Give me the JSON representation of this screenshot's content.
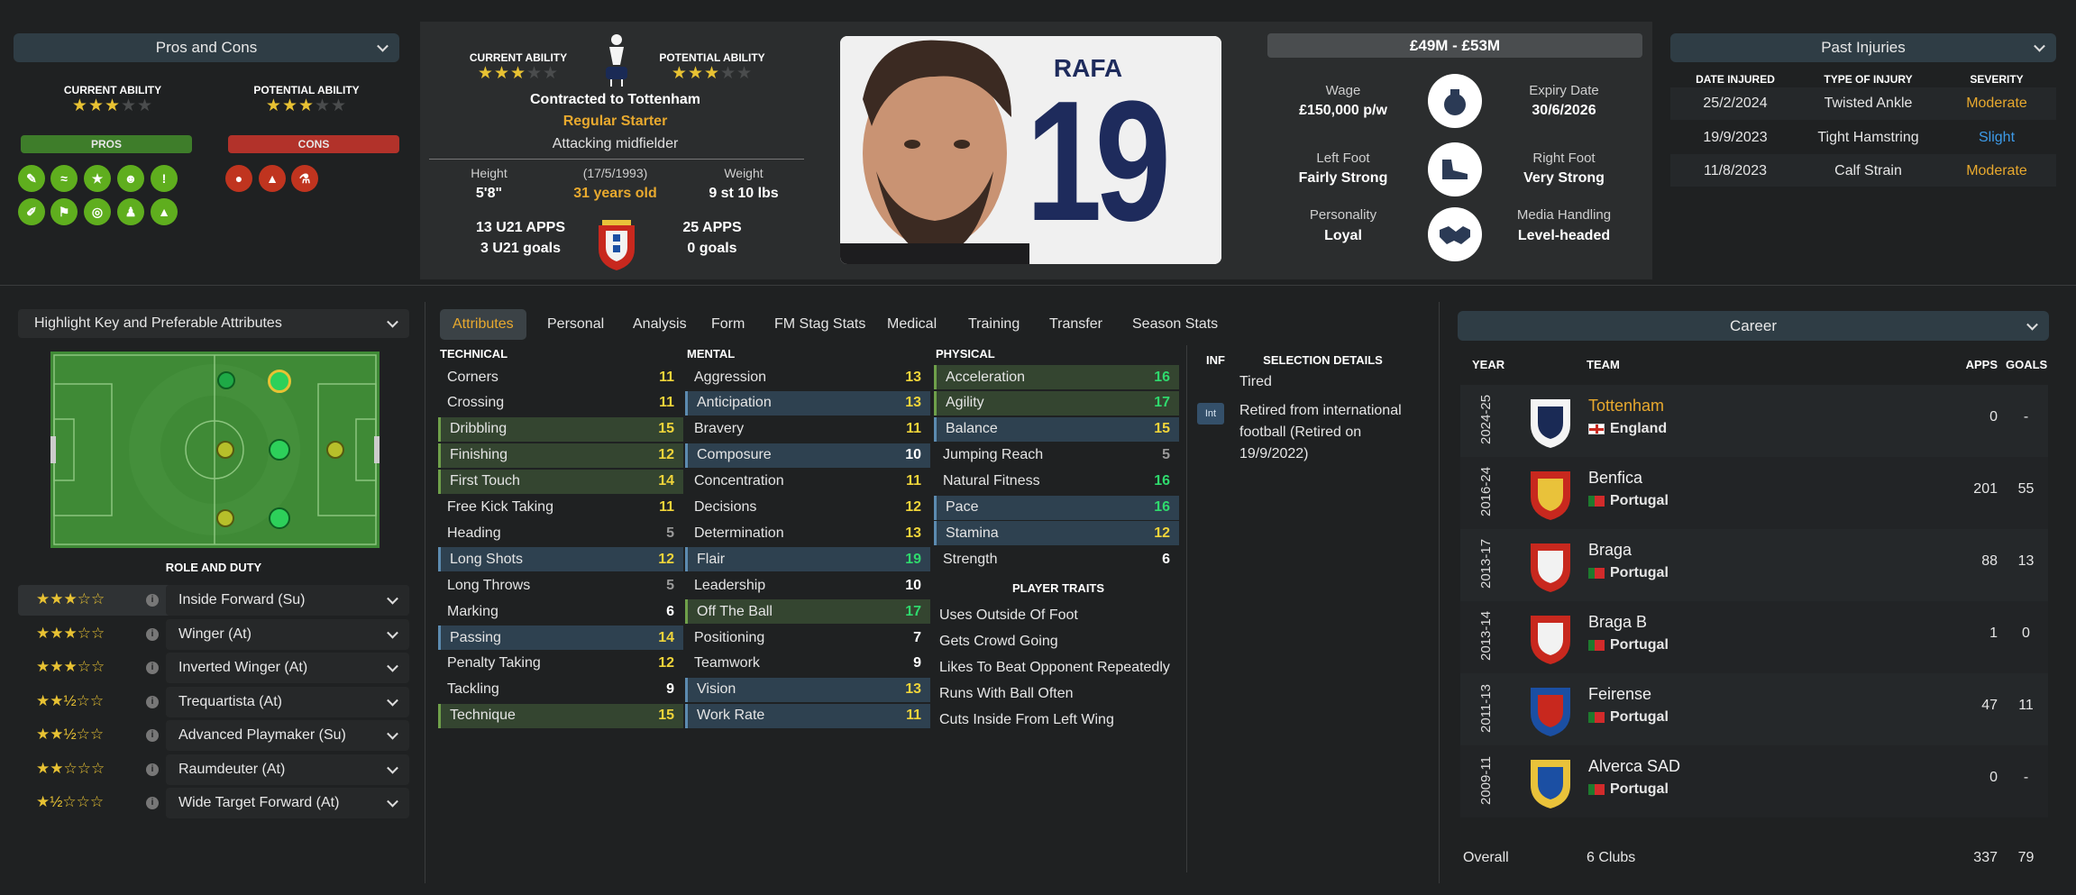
{
  "pros_cons": {
    "title": "Pros and Cons",
    "current_ability": "CURRENT ABILITY",
    "potential_ability": "POTENTIAL ABILITY",
    "current_stars": 3,
    "potential_stars": 3,
    "pros_label": "PROS",
    "cons_label": "CONS"
  },
  "profile": {
    "current_ability": "CURRENT ABILITY",
    "potential_ability": "POTENTIAL ABILITY",
    "contract": "Contracted to Tottenham",
    "status": "Regular Starter",
    "position": "Attacking midfielder",
    "height_label": "Height",
    "height": "5'8\"",
    "dob": "(17/5/1993)",
    "age": "31 years old",
    "weight_label": "Weight",
    "weight": "9 st 10 lbs",
    "u21_apps": "13 U21 APPS",
    "u21_goals": "3 U21 goals",
    "apps": "25 APPS",
    "goals": "0 goals"
  },
  "photo": {
    "name": "RAFA",
    "number": "19"
  },
  "details": {
    "value": "£49M - £53M",
    "wage_label": "Wage",
    "wage": "£150,000 p/w",
    "expiry_label": "Expiry Date",
    "expiry": "30/6/2026",
    "left_foot_label": "Left Foot",
    "left_foot": "Fairly Strong",
    "right_foot_label": "Right Foot",
    "right_foot": "Very Strong",
    "personality_label": "Personality",
    "personality": "Loyal",
    "media_label": "Media Handling",
    "media": "Level-headed"
  },
  "injuries": {
    "title": "Past Injuries",
    "headers": [
      "DATE INJURED",
      "TYPE OF INJURY",
      "SEVERITY"
    ],
    "rows": [
      {
        "date": "25/2/2024",
        "type": "Twisted Ankle",
        "severity": "Moderate",
        "color": "#e8a92e"
      },
      {
        "date": "19/9/2023",
        "type": "Tight Hamstring",
        "severity": "Slight",
        "color": "#3d9be9"
      },
      {
        "date": "11/8/2023",
        "type": "Calf Strain",
        "severity": "Moderate",
        "color": "#e8a92e"
      }
    ]
  },
  "highlight": {
    "title": "Highlight Key and Preferable Attributes",
    "role_duty": "ROLE AND DUTY"
  },
  "roles": [
    {
      "name": "Inside Forward (Su)",
      "stars": "★★★☆☆"
    },
    {
      "name": "Winger (At)",
      "stars": "★★★☆☆"
    },
    {
      "name": "Inverted Winger (At)",
      "stars": "★★★☆☆"
    },
    {
      "name": "Trequartista (At)",
      "stars": "★★½☆☆"
    },
    {
      "name": "Advanced Playmaker (Su)",
      "stars": "★★½☆☆"
    },
    {
      "name": "Raumdeuter (At)",
      "stars": "★★☆☆☆"
    },
    {
      "name": "Wide Target Forward (At)",
      "stars": "★½☆☆☆"
    }
  ],
  "tabs": [
    "Attributes",
    "Personal",
    "Analysis",
    "Form",
    "FM Stag Stats",
    "Medical",
    "Training",
    "Transfer",
    "Season Stats"
  ],
  "technical": {
    "title": "TECHNICAL",
    "items": [
      {
        "n": "Corners",
        "v": "11"
      },
      {
        "n": "Crossing",
        "v": "11"
      },
      {
        "n": "Dribbling",
        "v": "15"
      },
      {
        "n": "Finishing",
        "v": "12"
      },
      {
        "n": "First Touch",
        "v": "14"
      },
      {
        "n": "Free Kick Taking",
        "v": "11"
      },
      {
        "n": "Heading",
        "v": "5"
      },
      {
        "n": "Long Shots",
        "v": "12"
      },
      {
        "n": "Long Throws",
        "v": "5"
      },
      {
        "n": "Marking",
        "v": "6"
      },
      {
        "n": "Passing",
        "v": "14"
      },
      {
        "n": "Penalty Taking",
        "v": "12"
      },
      {
        "n": "Tackling",
        "v": "9"
      },
      {
        "n": "Technique",
        "v": "15"
      }
    ]
  },
  "mental": {
    "title": "MENTAL",
    "items": [
      {
        "n": "Aggression",
        "v": "13"
      },
      {
        "n": "Anticipation",
        "v": "13"
      },
      {
        "n": "Bravery",
        "v": "11"
      },
      {
        "n": "Composure",
        "v": "10"
      },
      {
        "n": "Concentration",
        "v": "11"
      },
      {
        "n": "Decisions",
        "v": "12"
      },
      {
        "n": "Determination",
        "v": "13"
      },
      {
        "n": "Flair",
        "v": "19"
      },
      {
        "n": "Leadership",
        "v": "10"
      },
      {
        "n": "Off The Ball",
        "v": "17"
      },
      {
        "n": "Positioning",
        "v": "7"
      },
      {
        "n": "Teamwork",
        "v": "9"
      },
      {
        "n": "Vision",
        "v": "13"
      },
      {
        "n": "Work Rate",
        "v": "11"
      }
    ]
  },
  "physical": {
    "title": "PHYSICAL",
    "items": [
      {
        "n": "Acceleration",
        "v": "16"
      },
      {
        "n": "Agility",
        "v": "17"
      },
      {
        "n": "Balance",
        "v": "15"
      },
      {
        "n": "Jumping Reach",
        "v": "5"
      },
      {
        "n": "Natural Fitness",
        "v": "16"
      },
      {
        "n": "Pace",
        "v": "16"
      },
      {
        "n": "Stamina",
        "v": "12"
      },
      {
        "n": "Strength",
        "v": "6"
      }
    ]
  },
  "traits": {
    "title": "PLAYER TRAITS",
    "items": [
      "Uses Outside Of Foot",
      "Gets Crowd Going",
      "Likes To Beat Opponent Repeatedly",
      "Runs With Ball Often",
      "Cuts Inside From Left Wing"
    ]
  },
  "selection": {
    "inf": "INF",
    "title": "SELECTION DETAILS",
    "tired": "Tired",
    "int_badge": "Int",
    "retired": "Retired from international football (Retired on 19/9/2022)"
  },
  "career": {
    "title": "Career",
    "headers": {
      "year": "YEAR",
      "team": "TEAM",
      "apps": "APPS",
      "goals": "GOALS"
    },
    "rows": [
      {
        "year": "2024-25",
        "team": "Tottenham",
        "country": "England",
        "apps": "0",
        "goals": "-"
      },
      {
        "year": "2016-24",
        "team": "Benfica",
        "country": "Portugal",
        "apps": "201",
        "goals": "55"
      },
      {
        "year": "2013-17",
        "team": "Braga",
        "country": "Portugal",
        "apps": "88",
        "goals": "13"
      },
      {
        "year": "2013-14",
        "team": "Braga B",
        "country": "Portugal",
        "apps": "1",
        "goals": "0"
      },
      {
        "year": "2011-13",
        "team": "Feirense",
        "country": "Portugal",
        "apps": "47",
        "goals": "11"
      },
      {
        "year": "2009-11",
        "team": "Alverca SAD",
        "country": "Portugal",
        "apps": "0",
        "goals": "-"
      }
    ],
    "overall_label": "Overall",
    "clubs": "6 Clubs",
    "total_apps": "337",
    "total_goals": "79"
  }
}
